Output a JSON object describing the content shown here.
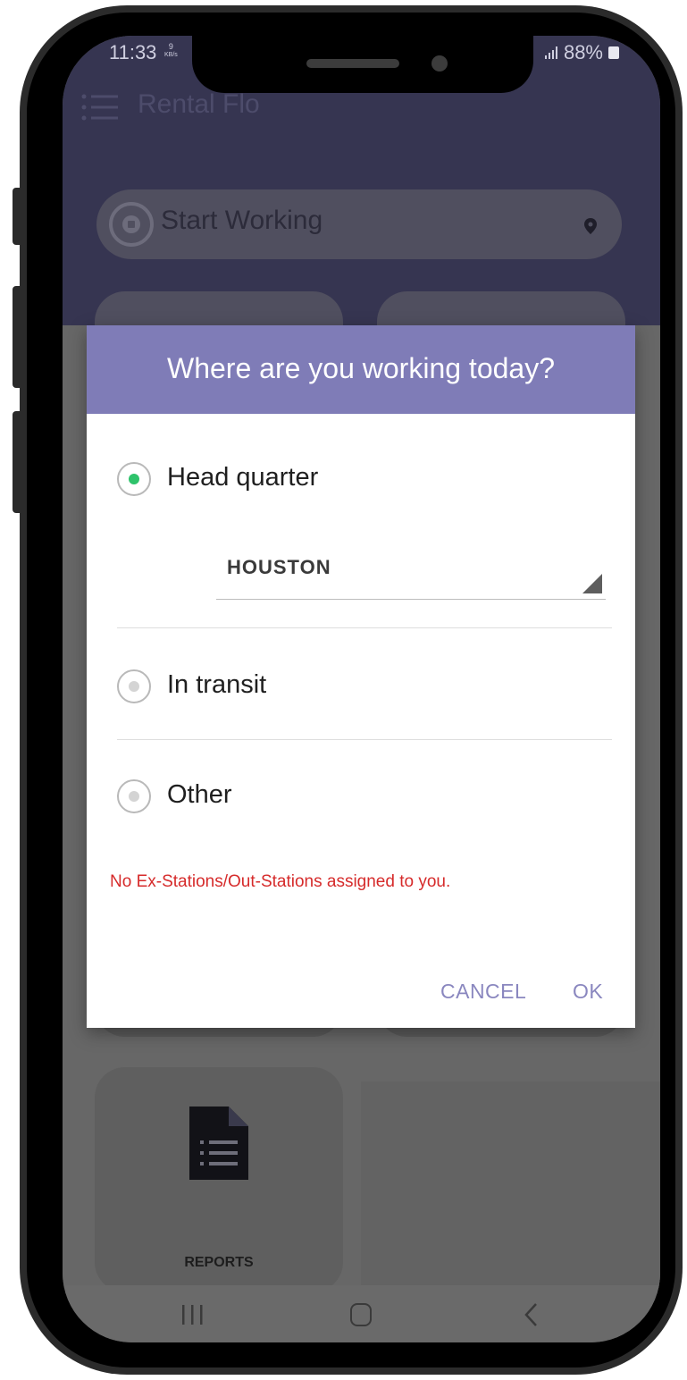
{
  "status_bar": {
    "time": "11:33",
    "speed_value": "9",
    "speed_unit": "KB/s",
    "battery": "88%"
  },
  "app": {
    "title": "Rental Flo",
    "start_button_label": "Start Working"
  },
  "dialog": {
    "title": "Where are you working today?",
    "options": [
      {
        "label": "Head quarter",
        "selected": true
      },
      {
        "label": "In transit",
        "selected": false
      },
      {
        "label": "Other",
        "selected": false
      }
    ],
    "location_select_value": "HOUSTON",
    "error_message": "No Ex-Stations/Out-Stations assigned to you.",
    "cancel_label": "CANCEL",
    "ok_label": "OK"
  },
  "tiles": {
    "reports_label": "REPORTS"
  },
  "colors": {
    "header_bg": "#363551",
    "dialog_header": "#7f7cb7",
    "radio_selected": "#2ec36b",
    "error_text": "#d62b2b",
    "dialog_button": "#8a87bf"
  },
  "icons": {
    "menu": "menu-icon",
    "start": "stop-circle-icon",
    "location": "location-pin-icon",
    "reports": "document-list-icon",
    "nav_recent": "recent-apps-icon",
    "nav_home": "home-icon",
    "nav_back": "back-icon"
  }
}
